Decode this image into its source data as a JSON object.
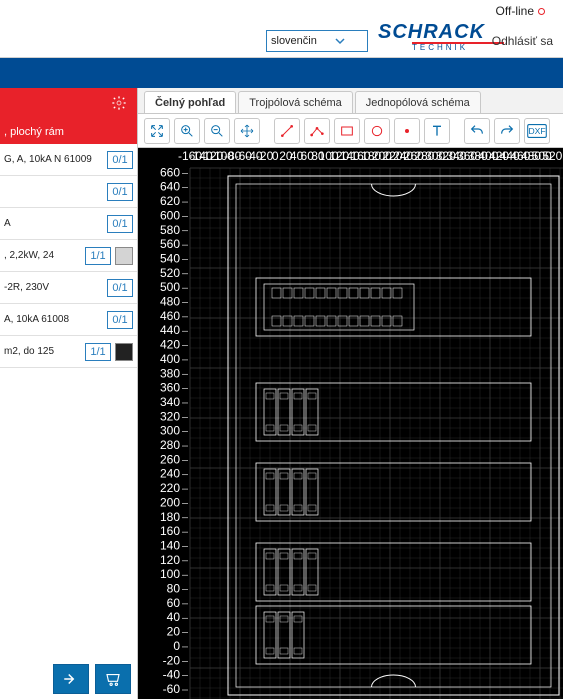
{
  "header": {
    "offline_label": "Off-line",
    "language": "slovenčina (Slovak)",
    "brand_main": "SCHRACK",
    "brand_sub": "TECHNIK",
    "logout": "Odhlásiť sa"
  },
  "sidebar": {
    "subtitle": ", plochý rám",
    "items": [
      {
        "label": "G, A, 10kA\nN 61009",
        "qty": "0/1",
        "thumb": false
      },
      {
        "label": "",
        "qty": "0/1",
        "thumb": false
      },
      {
        "label": "A",
        "qty": "0/1",
        "thumb": false
      },
      {
        "label": ", 2,2kW, 24",
        "qty": "1/1",
        "thumb": true,
        "dark": false
      },
      {
        "label": "-2R, 230V",
        "qty": "0/1",
        "thumb": false
      },
      {
        "label": "A, 10kA\n61008",
        "qty": "0/1",
        "thumb": false
      },
      {
        "label": "m2, do 125",
        "qty": "1/1",
        "thumb": true,
        "dark": true
      }
    ]
  },
  "tabs": [
    {
      "label": "Čelný pohľad",
      "active": true
    },
    {
      "label": "Trojpólová schéma",
      "active": false
    },
    {
      "label": "Jednopólová schéma",
      "active": false
    }
  ],
  "toolbar_icons": [
    "pan-icon",
    "zoom-in-icon",
    "zoom-out-icon",
    "move-icon",
    "line-icon",
    "polyline-icon",
    "rect-icon",
    "circle-icon",
    "dot-icon",
    "text-icon",
    "undo-icon",
    "redo-icon",
    "dxf-icon"
  ],
  "ruler": {
    "x": [
      -160,
      -140,
      -120,
      -100,
      -80,
      -60,
      -40,
      -20,
      0,
      20,
      40,
      60,
      80,
      100,
      120,
      140,
      160,
      180,
      200,
      220,
      240,
      260,
      280,
      300,
      320,
      340,
      360,
      380,
      400,
      420,
      440,
      460,
      480,
      500,
      520
    ],
    "y": [
      -60,
      -40,
      -20,
      0,
      20,
      40,
      60,
      80,
      100,
      120,
      140,
      160,
      180,
      200,
      220,
      240,
      260,
      280,
      300,
      320,
      340,
      360,
      380,
      400,
      420,
      440,
      460,
      480,
      500,
      520,
      540,
      560,
      580,
      600,
      620,
      640,
      660
    ]
  },
  "colors": {
    "red": "#e8222a",
    "blue": "#004b93"
  }
}
